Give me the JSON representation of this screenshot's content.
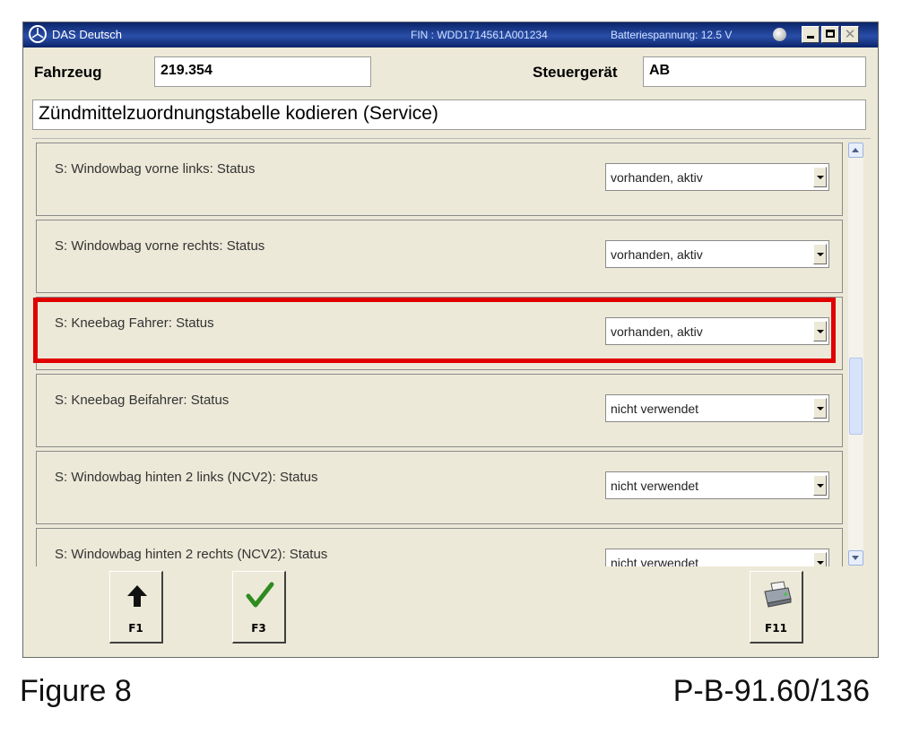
{
  "window": {
    "title": "DAS Deutsch",
    "fin": "FIN : WDD1714561A001234",
    "battery": "Batteriespannung: 12.5 V"
  },
  "header": {
    "vehicle_label": "Fahrzeug",
    "vehicle_value": "219.354",
    "ecu_label": "Steuergerät",
    "ecu_value": "AB"
  },
  "procedure_title": "Zündmittelzuordnungstabelle kodieren (Service)",
  "rows": [
    {
      "label": "S: Windowbag vorne links: Status",
      "value": "vorhanden, aktiv"
    },
    {
      "label": "S: Windowbag vorne rechts: Status",
      "value": "vorhanden, aktiv"
    },
    {
      "label": "S: Kneebag Fahrer: Status",
      "value": "vorhanden, aktiv"
    },
    {
      "label": "S: Kneebag Beifahrer: Status",
      "value": "nicht verwendet"
    },
    {
      "label": "S: Windowbag hinten 2 links (NCV2): Status",
      "value": "nicht verwendet"
    },
    {
      "label": "S: Windowbag hinten 2 rechts (NCV2): Status",
      "value": "nicht verwendet"
    }
  ],
  "function_keys": {
    "f1": {
      "label": "F1",
      "icon": "arrow-up-icon"
    },
    "f3": {
      "label": "F3",
      "icon": "checkmark-icon"
    },
    "f11": {
      "label": "F11",
      "icon": "printer-icon"
    }
  },
  "colors": {
    "highlight": "#e00000",
    "titlebar": "#0a246a",
    "checkmark": "#2e8b1e"
  },
  "caption": {
    "left": "Figure 8",
    "right": "P-B-91.60/136"
  }
}
